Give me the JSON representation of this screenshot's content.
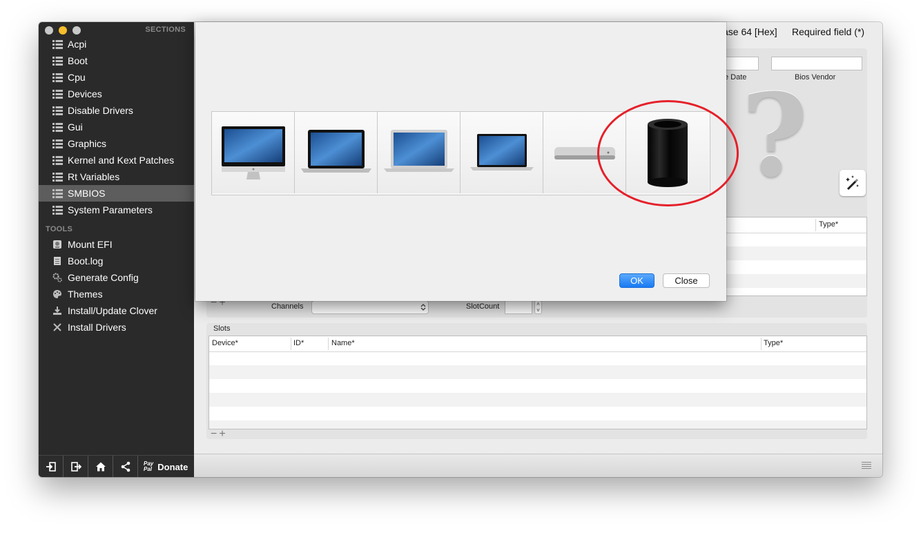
{
  "sidebar": {
    "sections_header": "SECTIONS",
    "items": [
      {
        "label": "Acpi"
      },
      {
        "label": "Boot"
      },
      {
        "label": "Cpu"
      },
      {
        "label": "Devices"
      },
      {
        "label": "Disable Drivers"
      },
      {
        "label": "Gui"
      },
      {
        "label": "Graphics"
      },
      {
        "label": "Kernel and Kext Patches"
      },
      {
        "label": "Rt Variables"
      },
      {
        "label": "SMBIOS"
      },
      {
        "label": "System Parameters"
      }
    ],
    "selected": "SMBIOS",
    "tools_header": "TOOLS",
    "tools": [
      {
        "label": "Mount EFI",
        "icon": "disk-icon"
      },
      {
        "label": "Boot.log",
        "icon": "log-icon"
      },
      {
        "label": "Generate Config",
        "icon": "gears-icon"
      },
      {
        "label": "Themes",
        "icon": "palette-icon"
      },
      {
        "label": "Install/Update Clover",
        "icon": "download-icon"
      },
      {
        "label": "Install Drivers",
        "icon": "tools-icon"
      }
    ],
    "bottom": {
      "donate_label": "Donate",
      "paypal_line1": "Pay",
      "paypal_line2": "Pal"
    }
  },
  "main": {
    "header_fragment": "ase 64 [Hex]",
    "required_note": "Required field (*)",
    "bios_date_fragment": "e Date",
    "bios_vendor_label": "Bios Vendor",
    "upper_table": {
      "type_header": "Type*"
    },
    "channels_label": "Channels",
    "slotcount_label": "SlotCount",
    "slots_label": "Slots",
    "slots_table": {
      "headers": [
        "Device*",
        "ID*",
        "Name*",
        "Type*"
      ]
    }
  },
  "sheet": {
    "models": [
      "imac",
      "macbook-pro",
      "macbook-air",
      "macbook",
      "mac-mini",
      "mac-pro"
    ],
    "selected_model": "mac-pro",
    "ok_label": "OK",
    "close_label": "Close"
  },
  "colors": {
    "accent": "#1a7af3",
    "highlight_circle": "#e5202a",
    "sidebar_bg": "#2a2a2a"
  }
}
